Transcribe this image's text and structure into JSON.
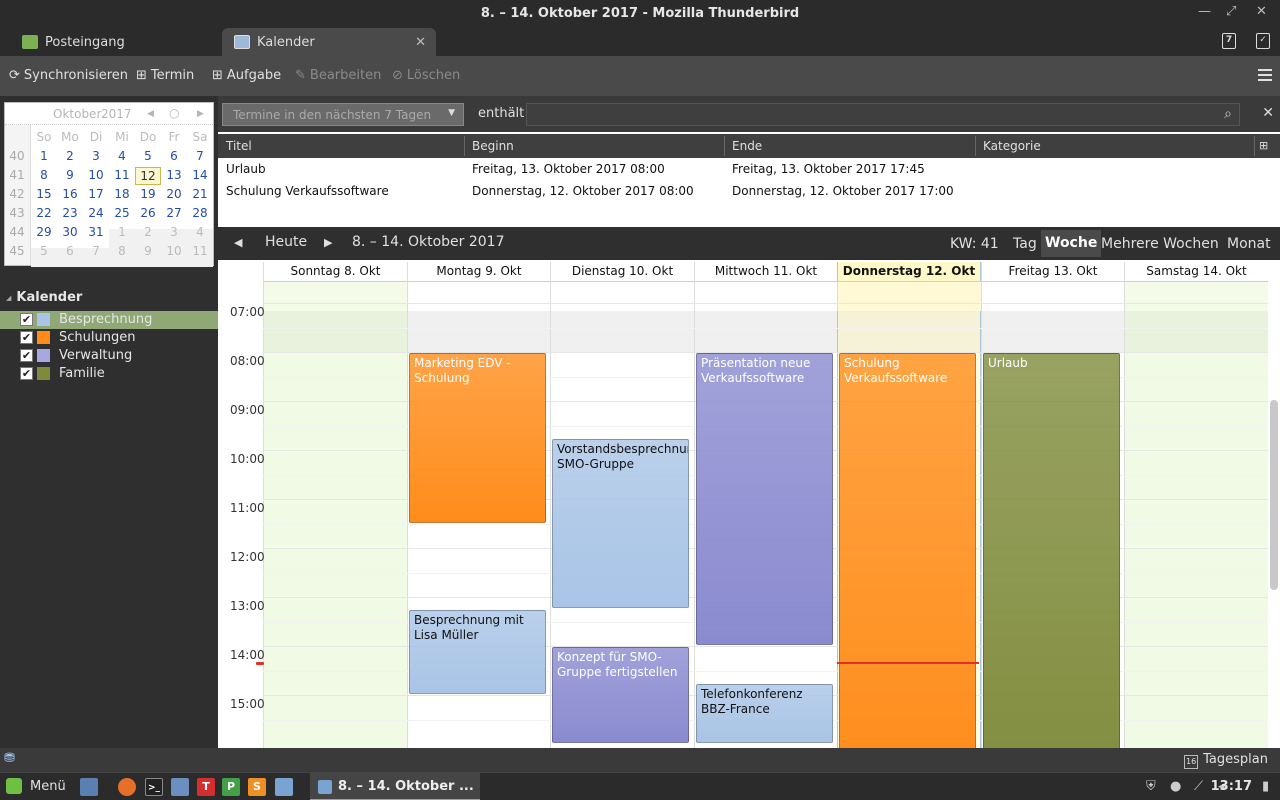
{
  "window": {
    "title": "8. – 14. Oktober 2017 - Mozilla Thunderbird"
  },
  "tabs": [
    {
      "label": "Posteingang",
      "icon": "inbox-icon"
    },
    {
      "label": "Kalender",
      "icon": "calendar-icon",
      "active": true
    }
  ],
  "toolbar": {
    "sync": "Synchronisieren",
    "event": "Termin",
    "task": "Aufgabe",
    "edit": "Bearbeiten",
    "delete": "Löschen"
  },
  "minicalendar": {
    "month": "Oktober",
    "year": "2017",
    "weekday_headers": [
      "So",
      "Mo",
      "Di",
      "Mi",
      "Do",
      "Fr",
      "Sa"
    ],
    "weeks": [
      {
        "week": "40",
        "days": [
          "1",
          "2",
          "3",
          "4",
          "5",
          "6",
          "7"
        ]
      },
      {
        "week": "41",
        "days": [
          "8",
          "9",
          "10",
          "11",
          "12",
          "13",
          "14"
        ]
      },
      {
        "week": "42",
        "days": [
          "15",
          "16",
          "17",
          "18",
          "19",
          "20",
          "21"
        ]
      },
      {
        "week": "43",
        "days": [
          "22",
          "23",
          "24",
          "25",
          "26",
          "27",
          "28"
        ]
      },
      {
        "week": "44",
        "days": [
          "29",
          "30",
          "31",
          "1",
          "2",
          "3",
          "4"
        ]
      },
      {
        "week": "45",
        "days": [
          "5",
          "6",
          "7",
          "8",
          "9",
          "10",
          "11"
        ]
      }
    ],
    "today": "12"
  },
  "calendars": {
    "heading": "Kalender",
    "items": [
      {
        "label": "Besprechnung",
        "color": "#a9c4e6",
        "checked": true,
        "selected": true
      },
      {
        "label": "Schulungen",
        "color": "#ff8c1a",
        "checked": true
      },
      {
        "label": "Verwaltung",
        "color": "#a8a8e0",
        "checked": true
      },
      {
        "label": "Familie",
        "color": "#7f8b3b",
        "checked": true
      }
    ]
  },
  "search": {
    "filter": "Termine in den nächsten 7 Tagen",
    "contains_label": "enthält",
    "value": ""
  },
  "event_list": {
    "columns": [
      "Titel",
      "Beginn",
      "Ende",
      "Kategorie"
    ],
    "rows": [
      {
        "title": "Urlaub",
        "start": "Freitag, 13. Oktober 2017 08:00",
        "end": "Freitag, 13. Oktober 2017 17:45",
        "category": ""
      },
      {
        "title": "Schulung Verkaufssoftware",
        "start": "Donnerstag, 12. Oktober 2017 08:00",
        "end": "Donnerstag, 12. Oktober 2017 17:00",
        "category": ""
      }
    ]
  },
  "nav": {
    "today": "Heute",
    "range": "8. – 14. Oktober 2017",
    "week_number": "KW: 41",
    "views": [
      "Tag",
      "Woche",
      "Mehrere Wochen",
      "Monat"
    ],
    "active_view": "Woche"
  },
  "week": {
    "days": [
      "Sonntag 8. Okt",
      "Montag 9. Okt",
      "Dienstag 10. Okt",
      "Mittwoch 11. Okt",
      "Donnerstag 12. Okt",
      "Freitag 13. Okt",
      "Samstag 14. Okt"
    ],
    "today_index": 4,
    "times": [
      "07:00",
      "08:00",
      "09:00",
      "10:00",
      "11:00",
      "12:00",
      "13:00",
      "14:00",
      "15:00"
    ],
    "events": [
      {
        "title": "Marketing EDV - Schulung",
        "day": 1,
        "start": "08:00",
        "end": "11:30",
        "color": "#ff8c1a"
      },
      {
        "title": "Besprechnung mit Lisa Müller",
        "day": 1,
        "start": "13:15",
        "end": "15:00",
        "color": "#a9c4e6"
      },
      {
        "title": "Vorstandsbesprechnung SMO-Gruppe",
        "day": 2,
        "start": "09:45",
        "end": "13:15",
        "color": "#a9c4e6"
      },
      {
        "title": "Konzept für SMO-Gruppe fertigstellen",
        "day": 2,
        "start": "14:00",
        "end": "16:00",
        "color": "#8a8ad0"
      },
      {
        "title": "Präsentation neue Verkaufssoftware",
        "day": 3,
        "start": "08:00",
        "end": "14:00",
        "color": "#8a8ad0"
      },
      {
        "title": "Telefonkonferenz BBZ-France",
        "day": 3,
        "start": "14:45",
        "end": "16:00",
        "color": "#a9c4e6"
      },
      {
        "title": "Schulung Verkaufssoftware",
        "day": 4,
        "start": "08:00",
        "end": "17:00",
        "color": "#ff8c1a"
      },
      {
        "title": "Urlaub",
        "day": 5,
        "start": "08:00",
        "end": "17:45",
        "color": "#7f8b3b"
      }
    ],
    "now": "14:20"
  },
  "statusbar": {
    "today_pane": "Tagesplan",
    "day_badge": "16"
  },
  "taskbar": {
    "menu": "Menü",
    "window_title": "8. – 14. Oktober ...",
    "clock": "13:17"
  }
}
